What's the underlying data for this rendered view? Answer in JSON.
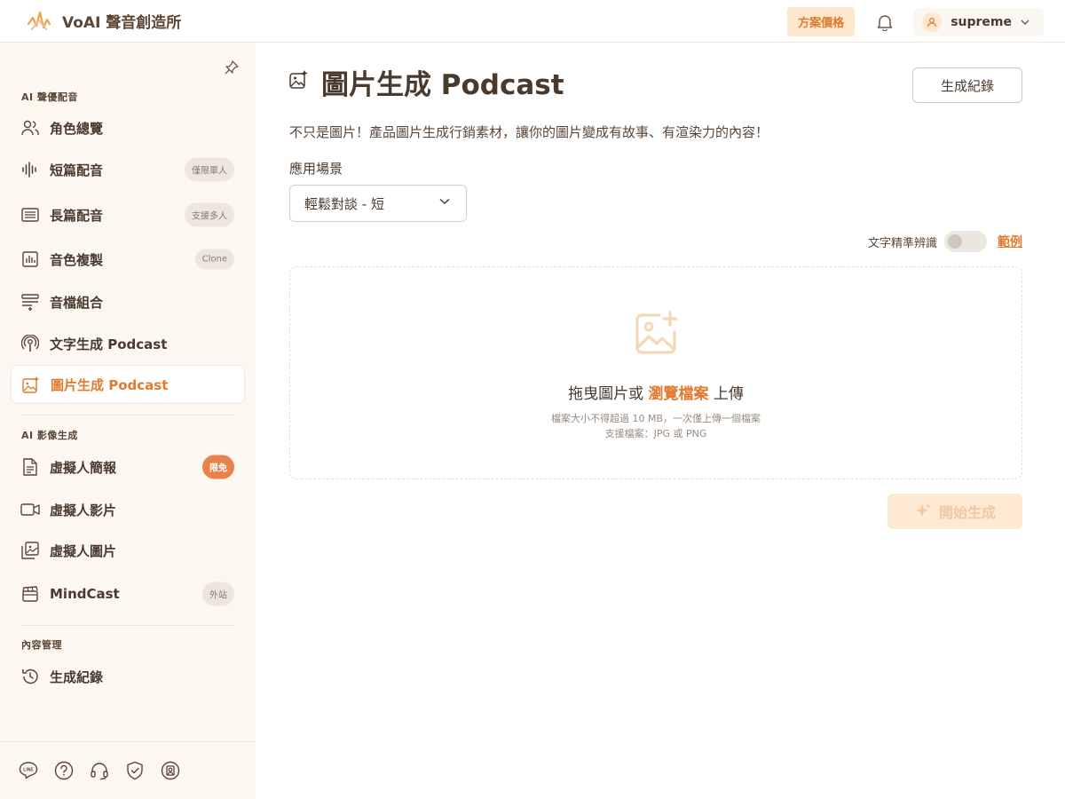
{
  "app": {
    "name": "VoAI 聲音創造所"
  },
  "header": {
    "pricing_label": "方案價格",
    "username": "supreme"
  },
  "sidebar": {
    "sections": [
      {
        "label": "AI 聲優配音"
      },
      {
        "label": "AI 影像生成"
      },
      {
        "label": "內容管理"
      }
    ],
    "items": [
      {
        "label": "角色總覽",
        "icon": "users-icon"
      },
      {
        "label": "短篇配音",
        "badge": "僅限單人",
        "icon": "waveform-icon"
      },
      {
        "label": "長篇配音",
        "badge": "支援多人",
        "icon": "document-list-icon"
      },
      {
        "label": "音色複製",
        "badge": "Clone",
        "icon": "voice-clone-icon"
      },
      {
        "label": "音檔組合",
        "icon": "audio-merge-icon"
      },
      {
        "label": "文字生成 Podcast",
        "icon": "podcast-icon"
      },
      {
        "label": "圖片生成 Podcast",
        "icon": "image-sparkle-icon",
        "active": true
      },
      {
        "label": "虛擬人簡報",
        "badge": "限免",
        "icon": "file-text-icon"
      },
      {
        "label": "虛擬人影片",
        "icon": "video-icon"
      },
      {
        "label": "虛擬人圖片",
        "icon": "images-icon"
      },
      {
        "label": "MindCast",
        "badge": "外站",
        "icon": "clapperboard-icon"
      },
      {
        "label": "生成紀錄",
        "icon": "history-icon"
      }
    ],
    "footer_icons": [
      "line-icon",
      "help-icon",
      "headset-icon",
      "shield-icon",
      "account-icon"
    ]
  },
  "main": {
    "title": "圖片生成 Podcast",
    "history_button": "生成紀錄",
    "description": "不只是圖片！產品圖片生成行銷素材，讓你的圖片變成有故事、有渲染力的內容！",
    "scene_label": "應用場景",
    "scene_value": "輕鬆對談 - 短",
    "ocr_label": "文字精準辨識",
    "ocr_enabled": false,
    "example_link": "範例",
    "dropzone": {
      "prefix": "拖曳圖片或",
      "browse": "瀏覽檔案",
      "suffix": "上傳",
      "size_note": "檔案大小不得超過 10 MB，一次僅上傳一個檔案",
      "format_note": "支援檔案：JPG 或 PNG"
    },
    "generate_button": "開始生成"
  },
  "colors": {
    "accent": "#e07b2e",
    "sidebar_bg": "#fdf7f1",
    "text": "#4a3a2e"
  }
}
